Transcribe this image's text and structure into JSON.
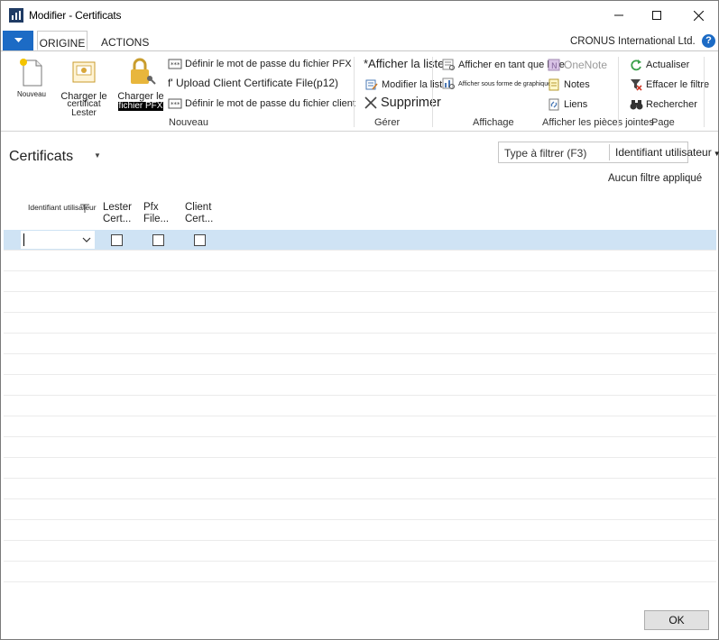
{
  "window": {
    "title": "Modifier - Certificats"
  },
  "ribbon_tabs": {
    "origine": "ORIGINE",
    "actions": "ACTIONS",
    "company": "CRONUS International Ltd.",
    "help": "?"
  },
  "ribbon": {
    "nouveau_group": {
      "label": "Nouveau",
      "new_label": "Nouveau",
      "load_lester_1": "Charger le",
      "load_lester_2": "certificat Lester",
      "load_pfx_1": "Charger le",
      "load_pfx_2": "fichier PFX",
      "set_pfx_password": "Définir le mot de passe du fichier PFX",
      "upload_client": "f' Upload Client Certificate File(p12)",
      "set_client_password": "Définir le mot de passe du fichier client"
    },
    "gerer_group": {
      "label": "Gérer",
      "show_list": "*Afficher la liste",
      "edit_list": "Modifier la liste",
      "delete": "Supprimer"
    },
    "affichage_group": {
      "label": "Affichage",
      "show_as_list": "Afficher en tant que liste",
      "show_as_chart": "Afficher sous forme de graphique"
    },
    "attachments_group": {
      "label": "Afficher les pièces jointes",
      "onenote": "OneNote",
      "notes": "Notes",
      "links": "Liens"
    },
    "page_group": {
      "label": "Page",
      "refresh": "Actualiser",
      "clear_filter": "Effacer le filtre",
      "find": "Rechercher"
    }
  },
  "content": {
    "page_title": "Certificats",
    "filter_placeholder": "Type à filtrer (F3)",
    "filter_field": "Identifiant utilisateur",
    "no_filter": "Aucun filtre appliqué",
    "columns": {
      "user_id": "Identifiant utilisateur",
      "lester_1": "Lester",
      "lester_2": "Cert...",
      "pfx_1": "Pfx",
      "pfx_2": "File...",
      "client_1": "Client",
      "client_2": "Cert..."
    }
  },
  "footer": {
    "ok": "OK"
  },
  "colors": {
    "accent": "#1c6bc5",
    "selected_row": "#cfe3f4"
  }
}
